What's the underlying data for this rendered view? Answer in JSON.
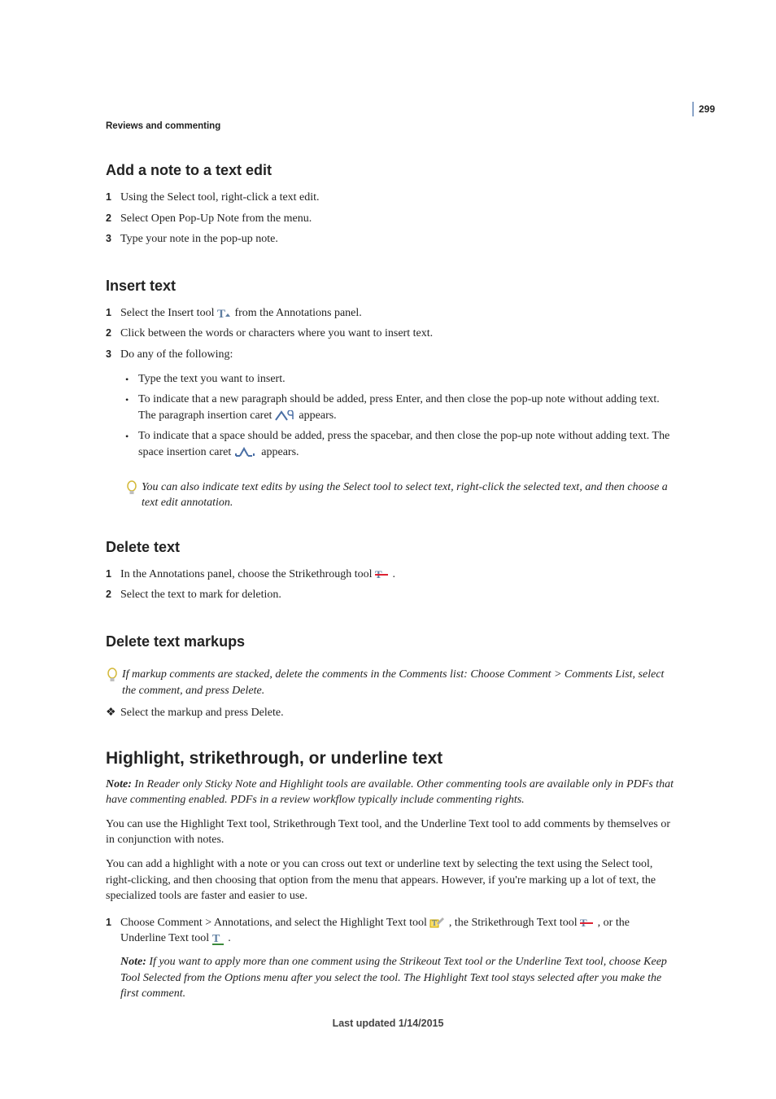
{
  "pageNumber": "299",
  "runningHead": "Reviews and commenting",
  "footer": "Last updated 1/14/2015",
  "s1": {
    "title": "Add a note to a text edit",
    "steps": [
      "Using the Select tool, right-click a text edit.",
      "Select Open Pop-Up Note from the menu.",
      "Type your note in the pop-up note."
    ]
  },
  "s2": {
    "title": "Insert text",
    "step1a": "Select the Insert tool ",
    "step1b": " from the Annotations panel.",
    "step2": "Click between the words or characters where you want to insert text.",
    "step3": "Do any of the following:",
    "b1": "Type the text you want to insert.",
    "b2a": "To indicate that a new paragraph should be added, press Enter, and then close the pop-up note without adding text. The paragraph insertion caret ",
    "b2b": " appears.",
    "b3a": "To indicate that a space should be added, press the spacebar, and then close the pop-up note without adding text. The space insertion caret ",
    "b3b": " appears.",
    "tip": "You can also indicate text edits by using the Select tool to select text, right-click the selected text, and then choose a text edit annotation."
  },
  "s3": {
    "title": "Delete text",
    "step1a": "In the Annotations panel, choose the Strikethrough tool ",
    "step1b": ".",
    "step2": "Select the text to mark for deletion."
  },
  "s4": {
    "title": "Delete text markups",
    "tip": "If markup comments are stacked, delete the comments in the Comments list: Choose Comment > Comments List, select the comment, and press Delete.",
    "bullet": "Select the markup and press Delete."
  },
  "s5": {
    "title": "Highlight, strikethrough, or underline text",
    "noteLabel": "Note: ",
    "note1": "In Reader only Sticky Note and Highlight tools are available. Other commenting tools are available only in PDFs that have commenting enabled. PDFs in a review workflow typically include commenting rights.",
    "p1": "You can use the Highlight Text tool, Strikethrough Text tool, and the Underline Text tool to add comments by themselves or in conjunction with notes.",
    "p2": "You can add a highlight with a note or you can cross out text or underline text by selecting the text using the Select tool, right-clicking, and then choosing that option from the menu that appears. However, if you're marking up a lot of text, the specialized tools are faster and easier to use.",
    "step1a": "Choose Comment > Annotations, and select the Highlight Text tool ",
    "step1b": ", the Strikethrough Text tool ",
    "step1c": ", or the Underline Text tool ",
    "step1d": ".",
    "note2": "If you want to apply more than one comment using the Strikeout Text tool or the Underline Text tool, choose Keep Tool Selected from the Options menu after you select the tool. The Highlight Text tool stays selected after you make the first comment."
  }
}
